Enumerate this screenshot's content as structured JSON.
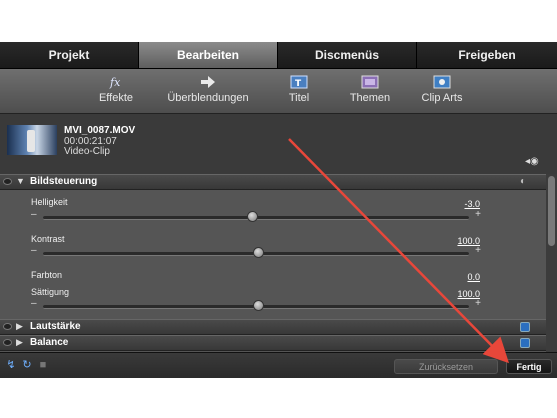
{
  "tabs": [
    {
      "label": "Projekt",
      "active": false
    },
    {
      "label": "Bearbeiten",
      "active": true
    },
    {
      "label": "Discmenüs",
      "active": false
    },
    {
      "label": "Freigeben",
      "active": false
    }
  ],
  "toolbar": {
    "items": [
      {
        "label": "Effekte",
        "icon": "fx-icon"
      },
      {
        "label": "Überblendungen",
        "icon": "arrow-icon"
      },
      {
        "label": "Titel",
        "icon": "title-icon"
      },
      {
        "label": "Themen",
        "icon": "themes-icon"
      },
      {
        "label": "Clip Arts",
        "icon": "clipart-icon"
      }
    ]
  },
  "clip": {
    "name": "MVI_0087.MOV",
    "duration": "00:00:21:07",
    "type": "Video-Clip"
  },
  "sections": {
    "bildsteuerung": {
      "title": "Bildsteuerung",
      "expanded": true,
      "params": [
        {
          "label": "Helligkeit",
          "value": "-3.0",
          "level": -3.0
        },
        {
          "label": "Kontrast",
          "value": "100.0",
          "level": 100.0
        },
        {
          "label": "Farbton",
          "value": "0.0"
        },
        {
          "label": "Sättigung",
          "value": "100.0",
          "level": 100.0
        }
      ]
    },
    "lautstaerke": {
      "title": "Lautstärke",
      "expanded": false
    },
    "balance": {
      "title": "Balance",
      "expanded": false
    }
  },
  "bottom": {
    "reset_label": "Zurücksetzen",
    "done_label": "Fertig"
  },
  "colors": {
    "active_tab": "#7a7a7a",
    "annotation_arrow": "#e8473a",
    "section_icon": "#2a6fc0"
  }
}
